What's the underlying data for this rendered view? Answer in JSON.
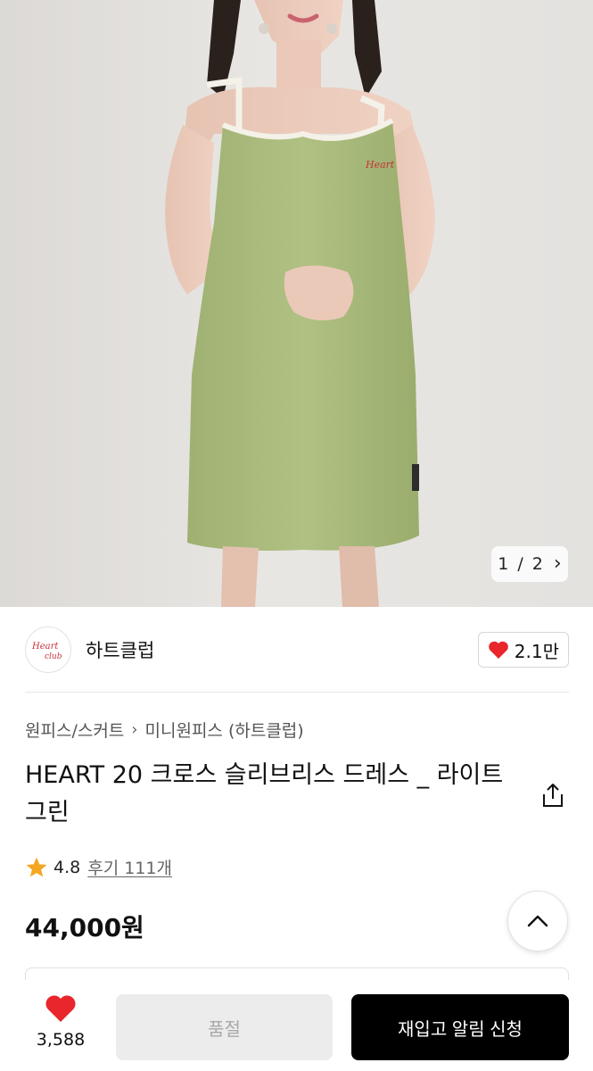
{
  "gallery": {
    "current": "1",
    "separator": "/",
    "total": "2"
  },
  "store": {
    "name": "하트클럽",
    "logo_text": "Heart club",
    "likes": "2.1만"
  },
  "breadcrumb": {
    "category": "원피스/스커트",
    "subcategory": "미니원피스 (하트클럽)"
  },
  "product": {
    "title": "HEART 20 크로스 슬리브리스 드레스 _ 라이트 그린",
    "rating": "4.8",
    "reviews": "후기 111개",
    "price": "44,000원"
  },
  "bottom": {
    "wish_count": "3,588",
    "soldout_label": "품절",
    "restock_label": "재입고 알림 신청"
  },
  "colors": {
    "accent_red": "#e8262b",
    "dress_green": "#a9bb7c",
    "dark_button": "#000000",
    "disabled_button": "#ececec"
  }
}
